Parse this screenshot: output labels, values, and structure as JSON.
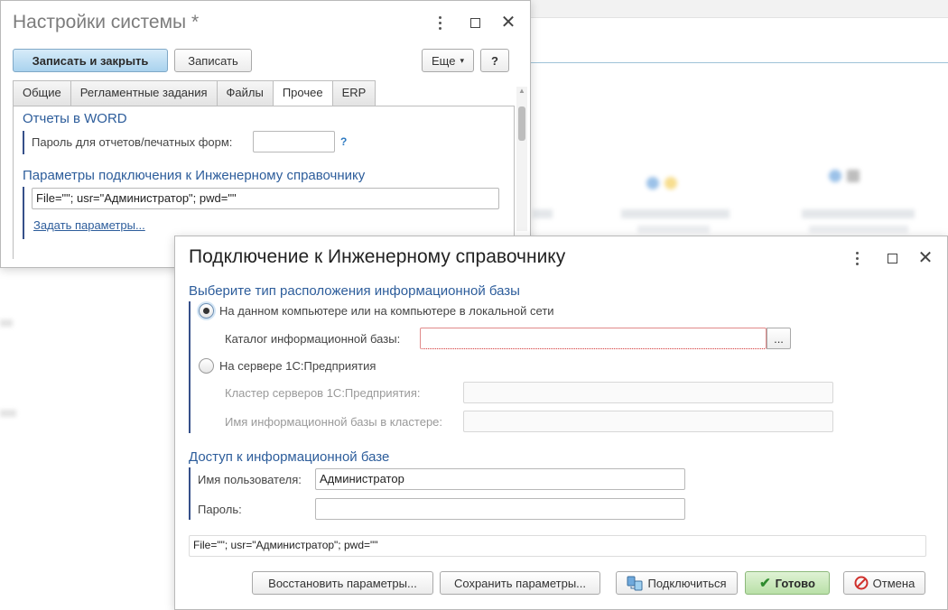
{
  "settings_window": {
    "title": "Настройки системы *",
    "buttons": {
      "save_close": "Записать и закрыть",
      "save": "Записать",
      "more": "Еще",
      "help": "?"
    },
    "tabs": [
      {
        "label": "Общие",
        "active": false
      },
      {
        "label": "Регламентные задания",
        "active": false
      },
      {
        "label": "Файлы",
        "active": false
      },
      {
        "label": "Прочее",
        "active": true
      },
      {
        "label": "ERP",
        "active": false
      }
    ],
    "section_word": {
      "title": "Отчеты в WORD",
      "password_label": "Пароль для отчетов/печатных форм:",
      "password_value": "",
      "help": "?"
    },
    "section_connection": {
      "title": "Параметры подключения к Инженерному справочнику",
      "connection_string": "File=\"\"; usr=\"Администратор\"; pwd=\"\"",
      "set_params_link": "Задать параметры..."
    }
  },
  "connect_dialog": {
    "title": "Подключение к Инженерному справочнику",
    "location": {
      "title": "Выберите тип расположения информационной базы",
      "option_local": "На данном компьютере или на компьютере в локальной сети",
      "option_local_selected": true,
      "catalog_label": "Каталог информационной базы:",
      "catalog_value": "",
      "browse_button": "...",
      "option_server": "На сервере 1С:Предприятия",
      "option_server_selected": false,
      "cluster_label": "Кластер серверов 1С:Предприятия:",
      "cluster_value": "",
      "ib_name_label": "Имя информационной базы в кластере:",
      "ib_name_value": ""
    },
    "access": {
      "title": "Доступ к информационной базе",
      "user_label": "Имя пользователя:",
      "user_value": "Администратор",
      "password_label": "Пароль:",
      "password_value": ""
    },
    "connection_string": "File=\"\"; usr=\"Администратор\"; pwd=\"\"",
    "buttons": {
      "restore": "Восстановить параметры...",
      "save_params": "Сохранить параметры...",
      "connect": "Подключиться",
      "done": "Готово",
      "cancel": "Отмена"
    }
  },
  "colors": {
    "section_title": "#2d5d9b",
    "primary_button": "#a9d2ee",
    "done_button": "#b9e0a7",
    "cancel_icon": "#d0312d"
  }
}
